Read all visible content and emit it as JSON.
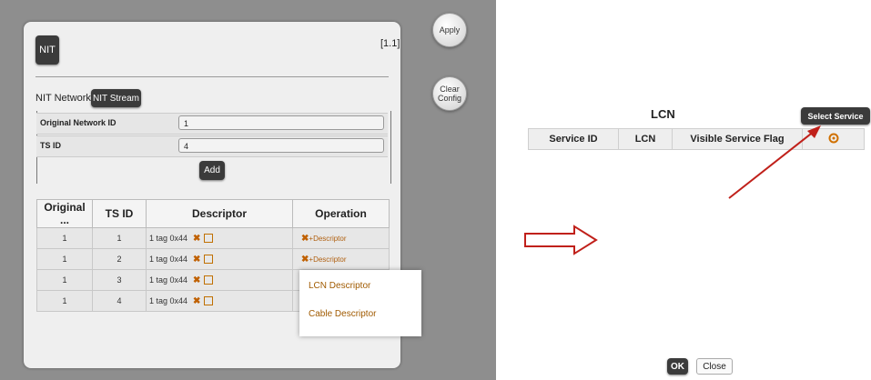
{
  "nit_panel": {
    "nit_button": "NIT",
    "version": "[1.1]",
    "apply": "Apply",
    "clear_config": "Clear Config",
    "tab_network": "NIT Network",
    "tab_stream": "NIT Stream",
    "original_network_id_label": "Original Network ID",
    "original_network_id_value": "1",
    "ts_id_label": "TS ID",
    "ts_id_value": "4",
    "add": "Add",
    "table": {
      "headers": [
        "Original ...",
        "TS ID",
        "Descriptor",
        "Operation"
      ],
      "rows": [
        {
          "original": "1",
          "ts_id": "1",
          "descriptor": "1 tag 0x44",
          "operation": "+Descriptor"
        },
        {
          "original": "1",
          "ts_id": "2",
          "descriptor": "1 tag 0x44",
          "operation": "+Descriptor"
        },
        {
          "original": "1",
          "ts_id": "3",
          "descriptor": "1 tag 0x44",
          "operation": ""
        },
        {
          "original": "1",
          "ts_id": "4",
          "descriptor": "1 tag 0x44",
          "operation": ""
        }
      ]
    },
    "popup": {
      "item1": "LCN Descriptor",
      "item2": "Cable Descriptor"
    }
  },
  "lcn_dialog": {
    "title": "LCN",
    "select_service": "Select Service",
    "headers": [
      "Service ID",
      "LCN",
      "Visible Service Flag"
    ],
    "ok": "OK",
    "close": "Close"
  },
  "colors": {
    "accent_orange": "#c06000",
    "arrow_red": "#c0201a"
  },
  "icons": [
    "delete-icon",
    "edit-icon",
    "plus-icon",
    "gear-icon",
    "right-arrow-icon"
  ]
}
